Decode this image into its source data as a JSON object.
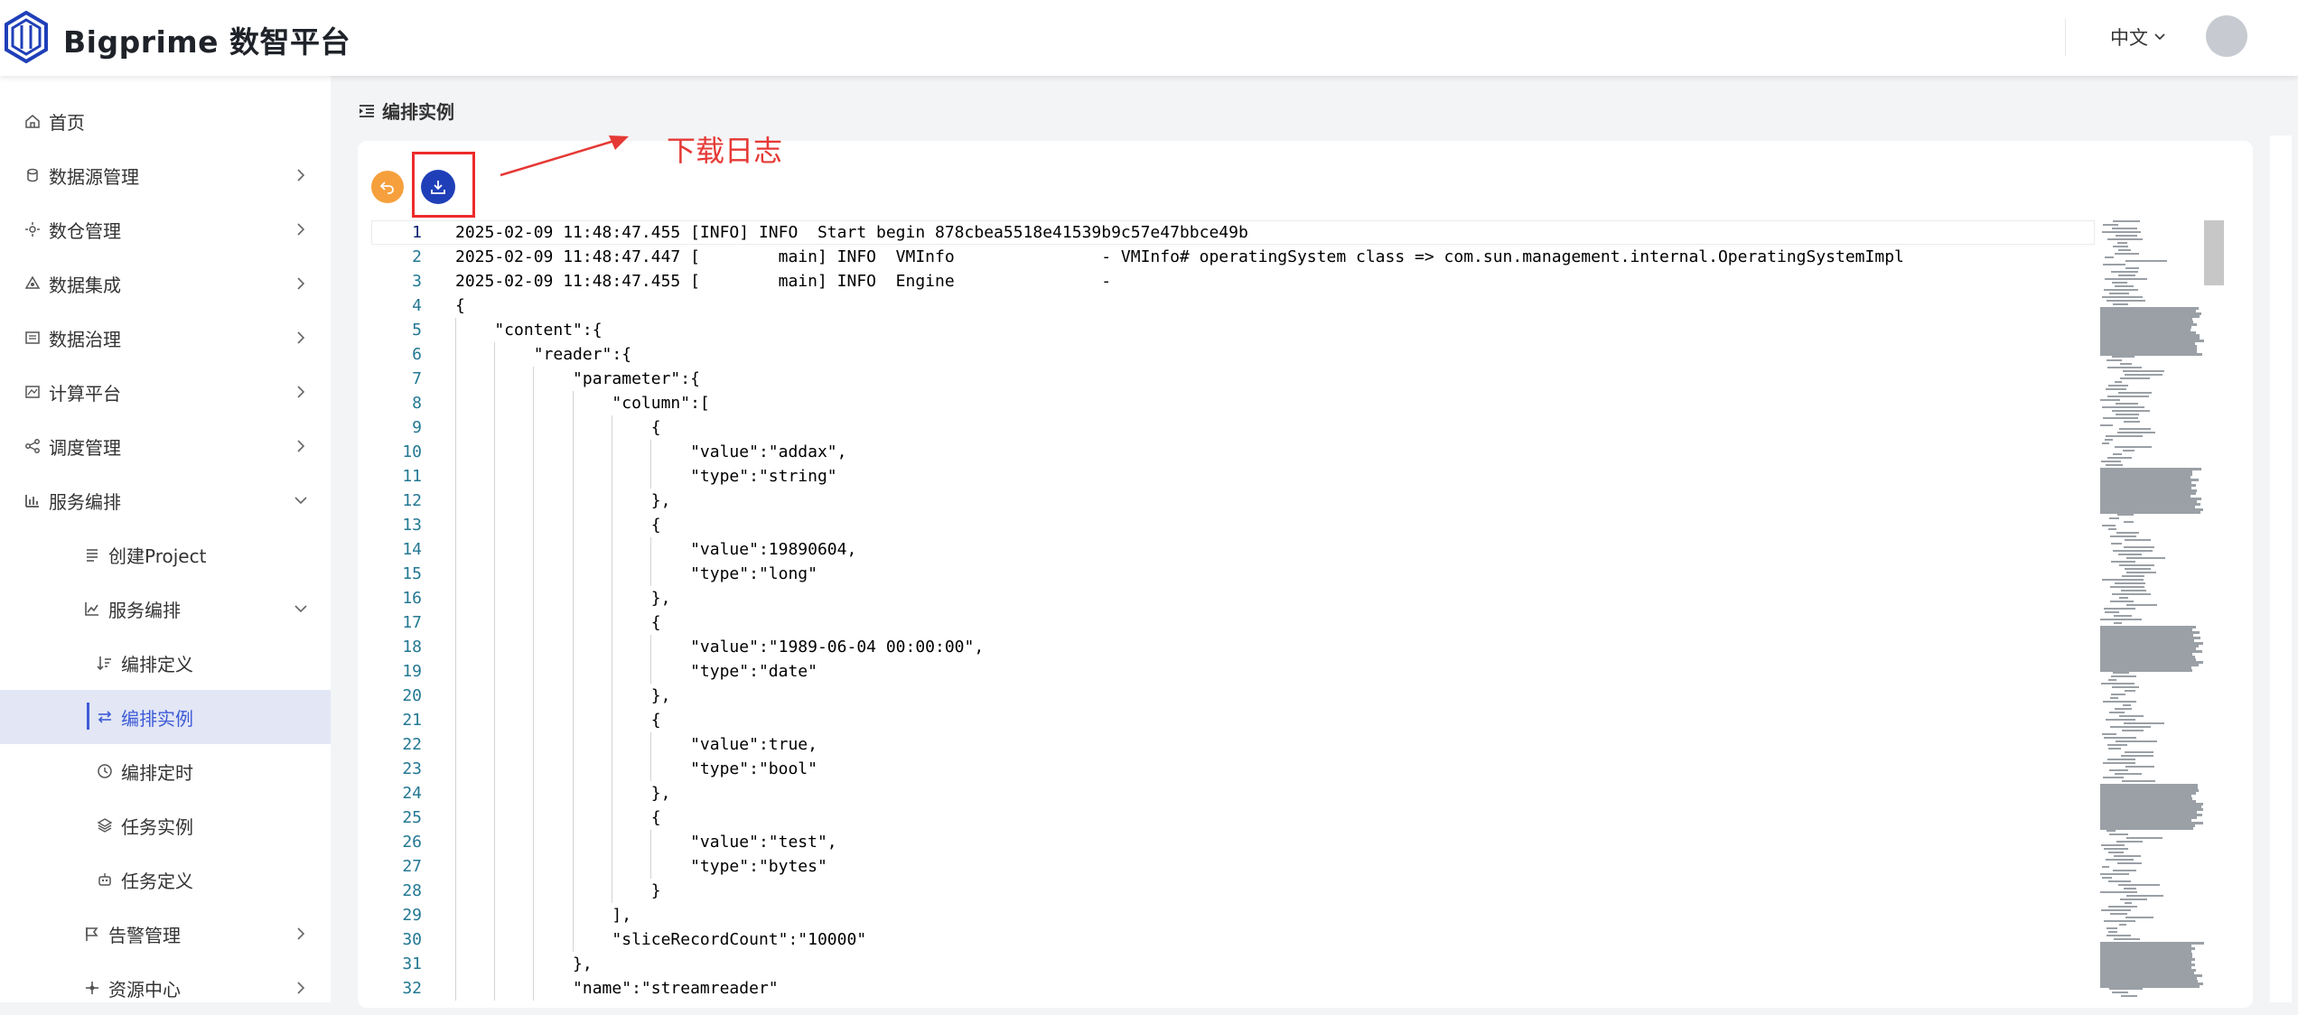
{
  "header": {
    "brand": "Bigprime 数智平台",
    "language": "中文"
  },
  "sidebar": {
    "items": [
      {
        "label": "首页",
        "icon": "home-icon"
      },
      {
        "label": "数据源管理",
        "icon": "database-icon"
      },
      {
        "label": "数仓管理",
        "icon": "warehouse-icon"
      },
      {
        "label": "数据集成",
        "icon": "integration-icon"
      },
      {
        "label": "数据治理",
        "icon": "governance-icon"
      },
      {
        "label": "计算平台",
        "icon": "compute-icon"
      },
      {
        "label": "调度管理",
        "icon": "share-nodes-icon"
      },
      {
        "label": "服务编排",
        "icon": "bar-chart-icon"
      },
      {
        "label": "创建Project",
        "icon": "list-icon"
      },
      {
        "label": "服务编排",
        "icon": "line-chart-icon"
      },
      {
        "label": "编排定义",
        "icon": "sort-icon"
      },
      {
        "label": "编排实例",
        "icon": "swap-icon"
      },
      {
        "label": "编排定时",
        "icon": "clock-icon"
      },
      {
        "label": "任务实例",
        "icon": "layers-icon"
      },
      {
        "label": "任务定义",
        "icon": "robot-icon"
      },
      {
        "label": "告警管理",
        "icon": "flag-icon"
      },
      {
        "label": "资源中心",
        "icon": "resource-icon"
      }
    ]
  },
  "main": {
    "title": "编排实例",
    "annotation": "下载日志"
  },
  "colors": {
    "accent": "#3d5bd6",
    "back_button": "#f6a03d",
    "download_button": "#1f3fb8",
    "annotation": "#e53935"
  },
  "log_lines": [
    "2025-02-09 11:48:47.455 [INFO] INFO  Start begin 878cbea5518e41539b9c57e47bbce49b",
    "2025-02-09 11:48:47.447 [        main] INFO  VMInfo               - VMInfo# operatingSystem class => com.sun.management.internal.OperatingSystemImpl",
    "2025-02-09 11:48:47.455 [        main] INFO  Engine               -",
    "{",
    "    \"content\":{",
    "        \"reader\":{",
    "            \"parameter\":{",
    "                \"column\":[",
    "                    {",
    "                        \"value\":\"addax\",",
    "                        \"type\":\"string\"",
    "                    },",
    "                    {",
    "                        \"value\":19890604,",
    "                        \"type\":\"long\"",
    "                    },",
    "                    {",
    "                        \"value\":\"1989-06-04 00:00:00\",",
    "                        \"type\":\"date\"",
    "                    },",
    "                    {",
    "                        \"value\":true,",
    "                        \"type\":\"bool\"",
    "                    },",
    "                    {",
    "                        \"value\":\"test\",",
    "                        \"type\":\"bytes\"",
    "                    }",
    "                ],",
    "                \"sliceRecordCount\":\"10000\"",
    "            },",
    "            \"name\":\"streamreader\""
  ]
}
